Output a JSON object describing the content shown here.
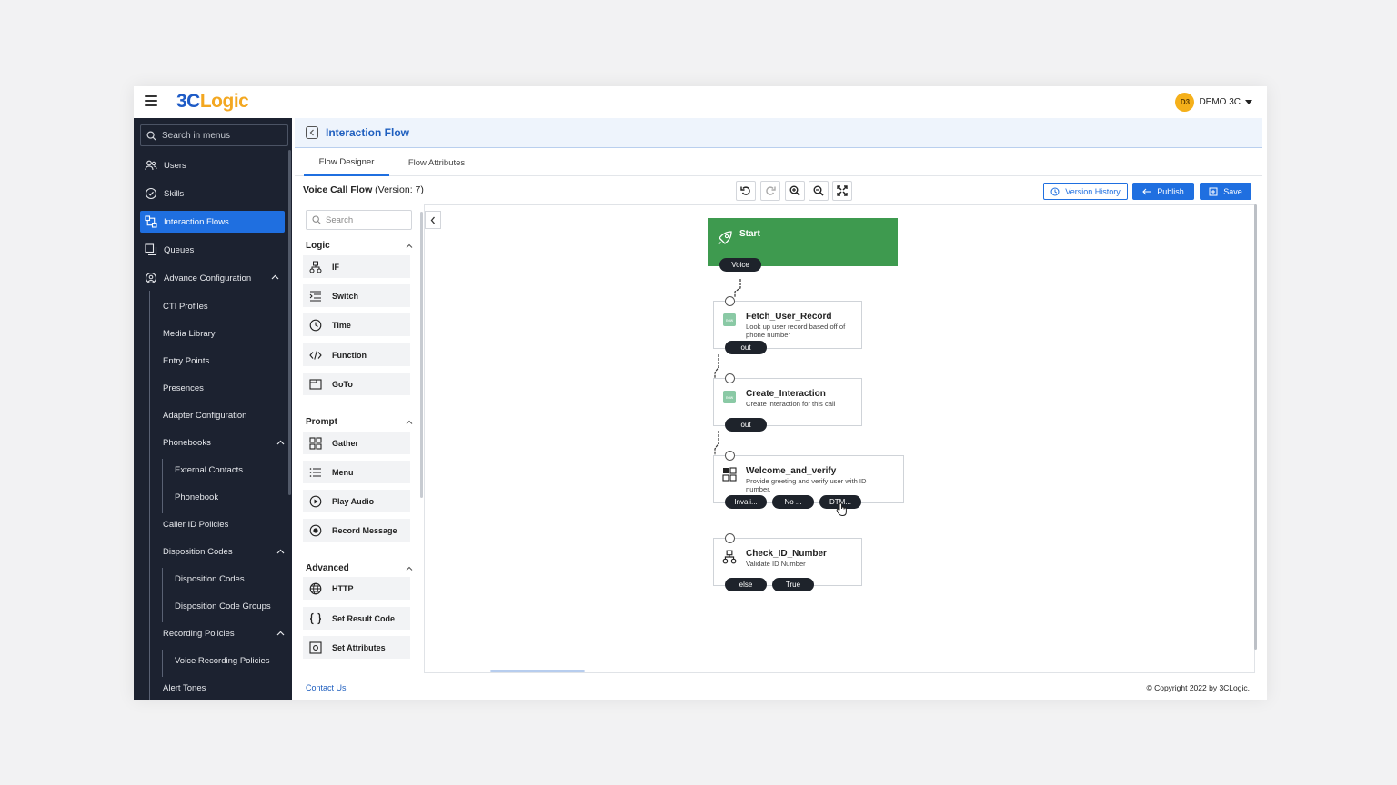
{
  "app": {
    "logo_part1": "3C",
    "logo_part2": "Logic",
    "user_initials": "D3",
    "user_name": "DEMO 3C",
    "colors": {
      "brand_blue": "#1e5bc6",
      "brand_orange": "#f3a720",
      "accent": "#1f6fe0",
      "sidebar_bg": "#1c2230",
      "start_node": "#3e9a4f"
    }
  },
  "sidebar": {
    "search_placeholder": "Search in menus",
    "items": [
      {
        "label": "Users",
        "icon": "users-icon"
      },
      {
        "label": "Skills",
        "icon": "skills-icon"
      },
      {
        "label": "Interaction Flows",
        "icon": "flow-icon",
        "active": true
      },
      {
        "label": "Queues",
        "icon": "queues-icon"
      },
      {
        "label": "Advance Configuration",
        "icon": "gear-icon",
        "expanded": true
      }
    ],
    "sub_items": [
      "CTI Profiles",
      "Media Library",
      "Entry Points",
      "Presences",
      "Adapter Configuration",
      "Phonebooks",
      "External Contacts",
      "Phonebook",
      "Caller ID Policies",
      "Disposition Codes",
      "Disposition Codes",
      "Disposition Code Groups",
      "Recording Policies",
      "Voice Recording Policies",
      "Alert Tones"
    ]
  },
  "header": {
    "title": "Interaction Flow"
  },
  "tabs": [
    {
      "label": "Flow Designer",
      "active": true
    },
    {
      "label": "Flow Attributes",
      "active": false
    }
  ],
  "toolbar": {
    "flow_name": "Voice Call Flow",
    "flow_version": "(Version: 7)",
    "version_history_label": "Version History",
    "publish_label": "Publish",
    "save_label": "Save"
  },
  "palette": {
    "search_placeholder": "Search",
    "groups": [
      {
        "label": "Logic",
        "items": [
          {
            "label": "IF",
            "icon": "branch-icon"
          },
          {
            "label": "Switch",
            "icon": "switch-icon"
          },
          {
            "label": "Time",
            "icon": "clock-icon"
          },
          {
            "label": "Function",
            "icon": "code-icon"
          },
          {
            "label": "GoTo",
            "icon": "goto-icon"
          }
        ]
      },
      {
        "label": "Prompt",
        "items": [
          {
            "label": "Gather",
            "icon": "gather-icon"
          },
          {
            "label": "Menu",
            "icon": "menu-list-icon"
          },
          {
            "label": "Play Audio",
            "icon": "play-icon"
          },
          {
            "label": "Record Message",
            "icon": "record-icon"
          }
        ]
      },
      {
        "label": "Advanced",
        "items": [
          {
            "label": "HTTP",
            "icon": "globe-icon"
          },
          {
            "label": "Set Result Code",
            "icon": "braces-icon"
          },
          {
            "label": "Set Attributes",
            "icon": "attributes-icon"
          }
        ]
      }
    ]
  },
  "flow": {
    "start": {
      "title": "Start",
      "output": "Voice"
    },
    "nodes": [
      {
        "title": "Fetch_User_Record",
        "description": "Look up user record based off of phone number",
        "outputs": [
          "out"
        ]
      },
      {
        "title": "Create_Interaction",
        "description": "Create interaction for this call",
        "outputs": [
          "out"
        ]
      },
      {
        "title": "Welcome_and_verify",
        "description": "Provide greeting and verify user with ID number.",
        "outputs": [
          "Invali...",
          "No ...",
          "DTM..."
        ]
      },
      {
        "title": "Check_ID_Number",
        "description": "Validate ID Number",
        "outputs": [
          "else",
          "True"
        ]
      }
    ]
  },
  "footer": {
    "contact_label": "Contact Us",
    "copyright": "© Copyright 2022 by 3CLogic."
  }
}
